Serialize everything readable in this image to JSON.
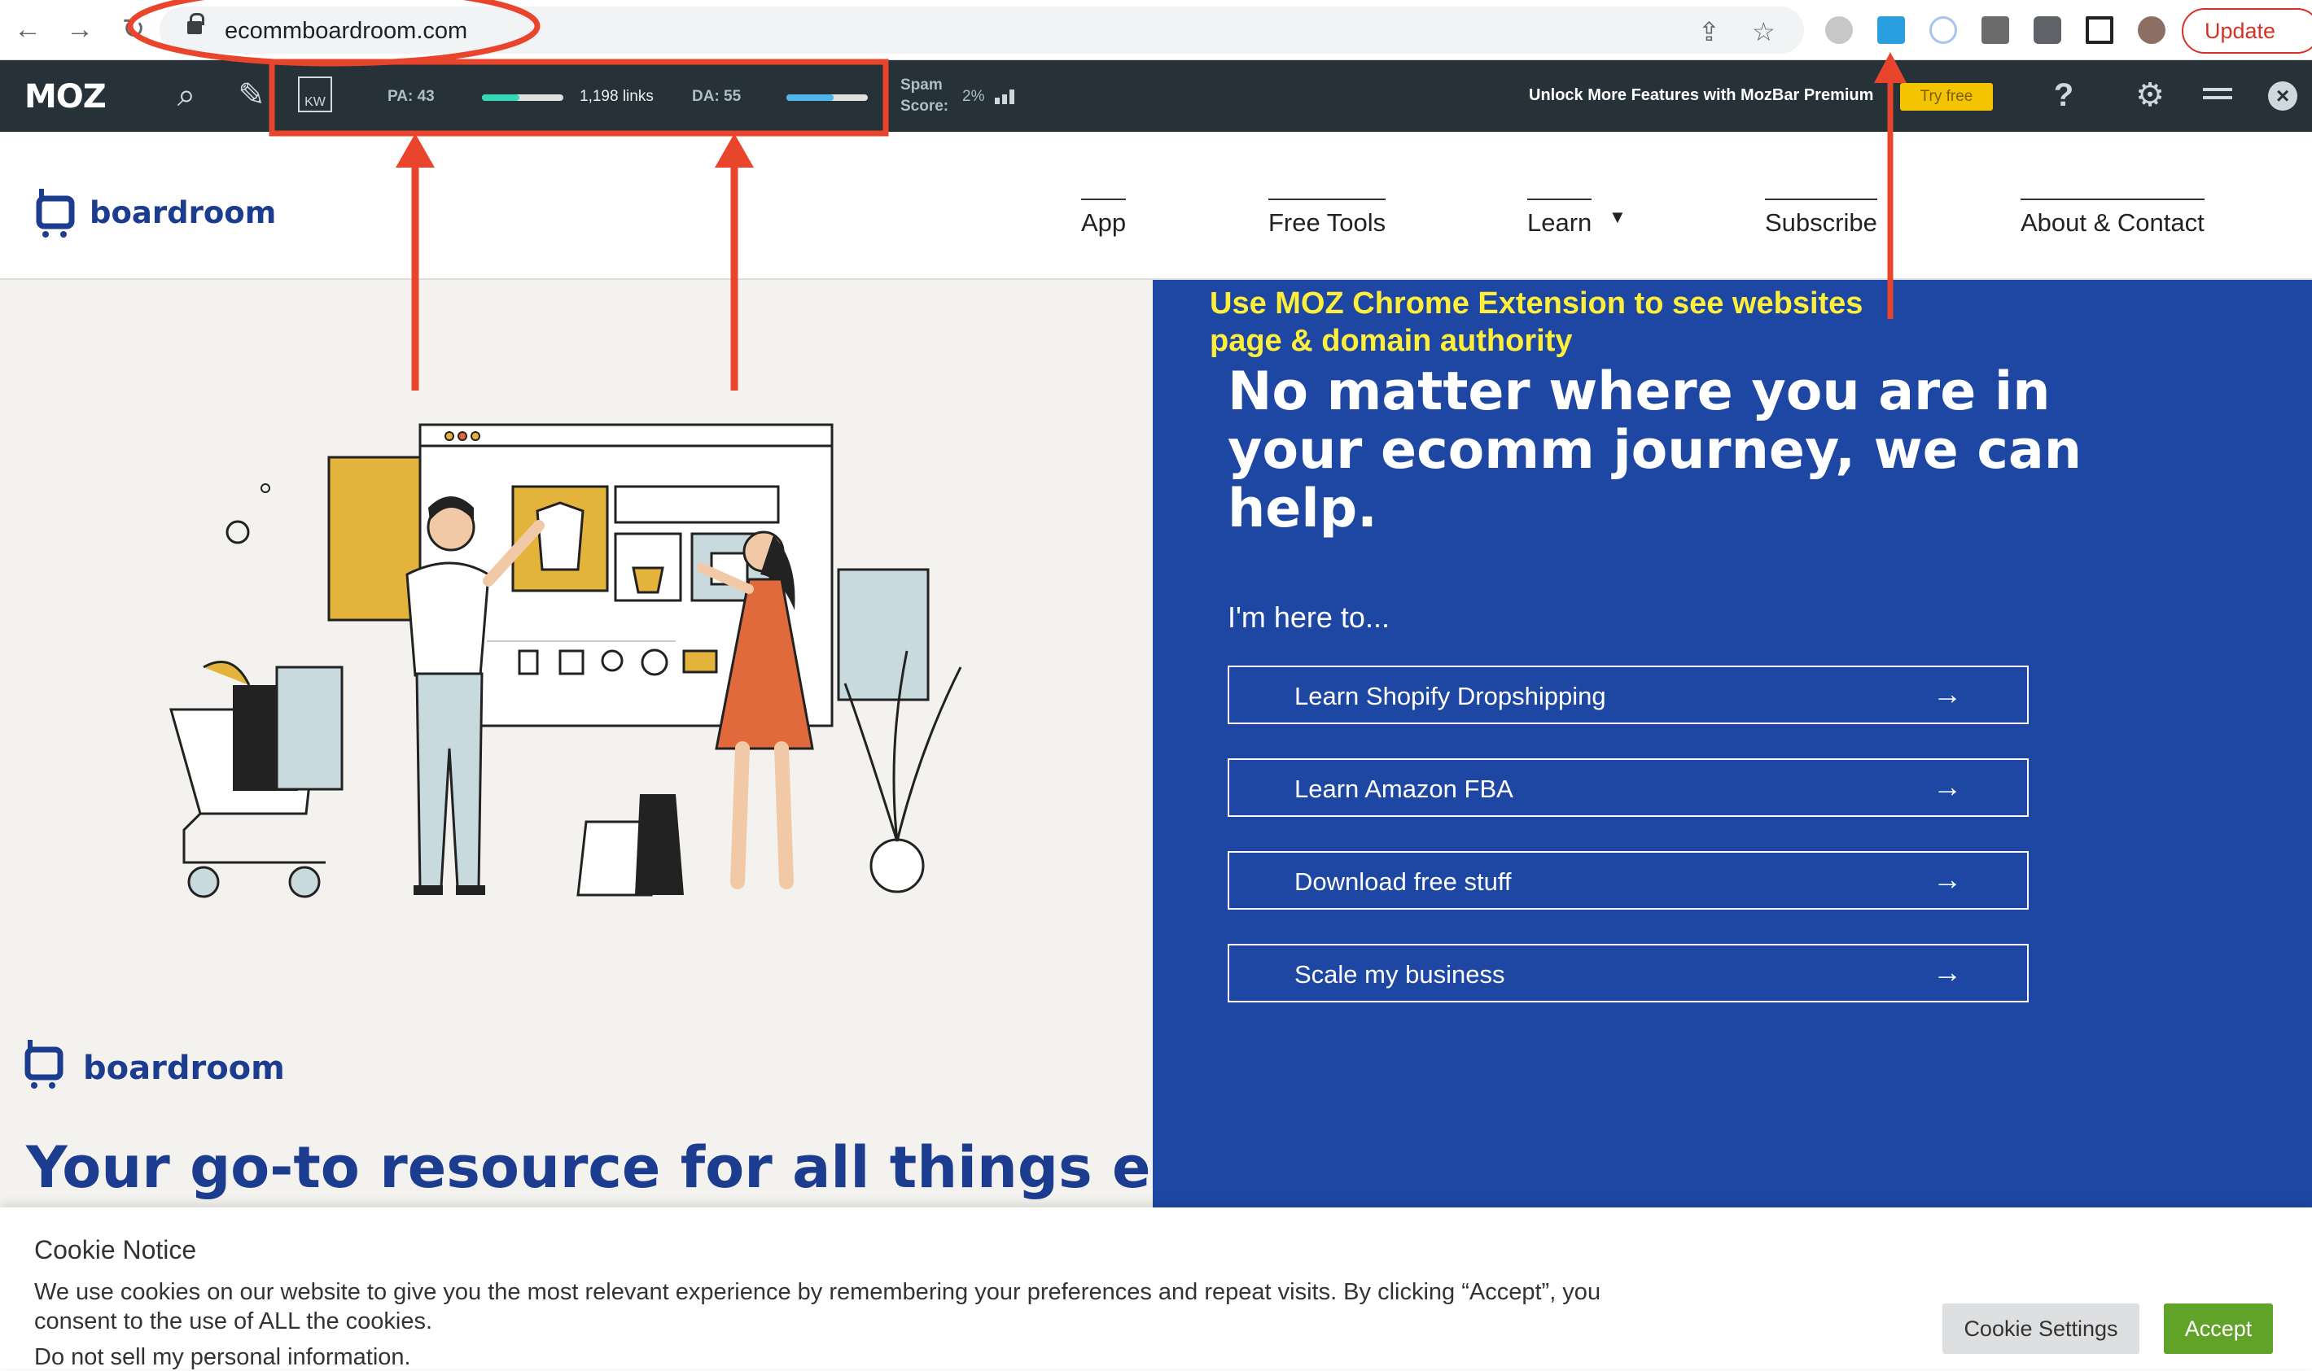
{
  "browser": {
    "url": "ecommboardroom.com",
    "update_label": "Update"
  },
  "mozbar": {
    "logo": "MOZ",
    "kw_label": "KW",
    "pa": "PA: 43",
    "links": "1,198 links",
    "da": "DA: 55",
    "spam_label_1": "Spam",
    "spam_label_2": "Score:",
    "spam_value": "2%",
    "premium_text": "Unlock More Features with MozBar Premium",
    "try_free": "Try free",
    "help": "?"
  },
  "site": {
    "brand": "boardroom",
    "nav": [
      "App",
      "Free Tools",
      "Learn",
      "Subscribe",
      "About & Contact"
    ]
  },
  "annotation": {
    "line1": "Use MOZ Chrome Extension to see websites",
    "line2": "page & domain authority"
  },
  "hero": {
    "headline": "No matter where you are in your ecomm journey, we can help.",
    "here_to": "I'm here to...",
    "ctas": [
      "Learn Shopify Dropshipping",
      "Learn Amazon FBA",
      "Download free stuff",
      "Scale my business"
    ],
    "arrow": "→",
    "tagline": "Your go-to resource for all things e-"
  },
  "cookie": {
    "title": "Cookie Notice",
    "body": "We use cookies on our website to give you the most relevant experience by remembering your preferences and repeat visits. By clicking “Accept”, you consent to the use of ALL the cookies.",
    "link": "Do not sell my personal information.",
    "settings_label": "Cookie Settings",
    "accept_label": "Accept"
  },
  "colors": {
    "brand_blue": "#1d47a3",
    "annotation_red": "#e8452c",
    "annotation_yellow": "#ffef3a",
    "accept_green": "#61a229",
    "moz_bar": "#263238"
  }
}
